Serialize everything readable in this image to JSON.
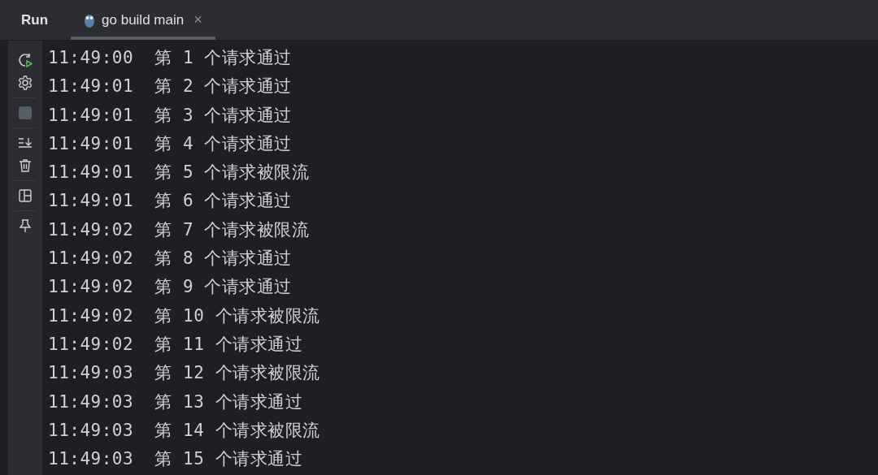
{
  "tool_window": {
    "title": "Run",
    "tabs": [
      {
        "label": "go build main",
        "selected": true,
        "close": "×"
      }
    ]
  },
  "console": {
    "lines": [
      "11:49:00  第 1 个请求通过",
      "11:49:01  第 2 个请求通过",
      "11:49:01  第 3 个请求通过",
      "11:49:01  第 4 个请求通过",
      "11:49:01  第 5 个请求被限流",
      "11:49:01  第 6 个请求通过",
      "11:49:02  第 7 个请求被限流",
      "11:49:02  第 8 个请求通过",
      "11:49:02  第 9 个请求通过",
      "11:49:02  第 10 个请求被限流",
      "11:49:02  第 11 个请求通过",
      "11:49:03  第 12 个请求被限流",
      "11:49:03  第 13 个请求通过",
      "11:49:03  第 14 个请求被限流",
      "11:49:03  第 15 个请求通过"
    ]
  }
}
